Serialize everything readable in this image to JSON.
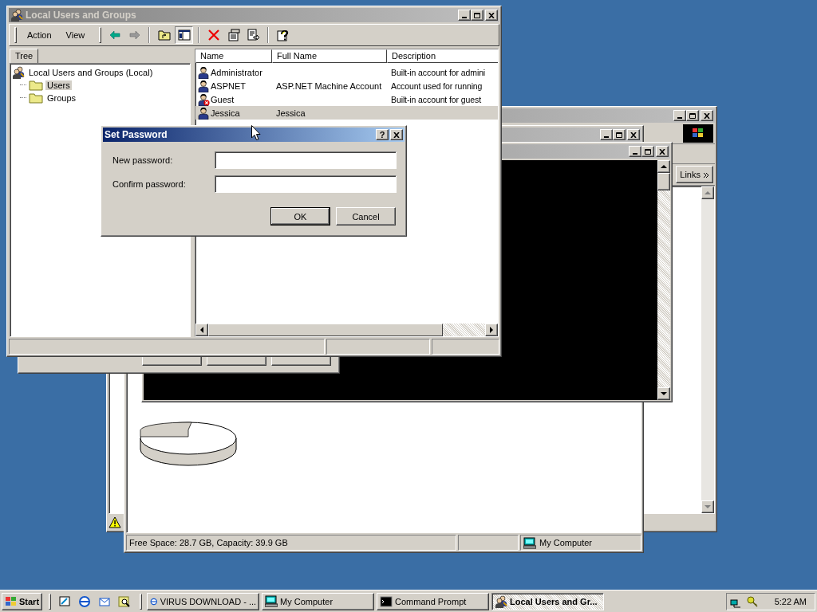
{
  "browser_window": {
    "links_label": "Links"
  },
  "explorer_window": {
    "status_bar": {
      "space": "Free Space: 28.7 GB, Capacity: 39.9 GB",
      "location": "My Computer"
    }
  },
  "main_window": {
    "title": "Local Users and Groups",
    "menu": [
      "Action",
      "View"
    ],
    "tree_tab": "Tree",
    "tree": [
      {
        "label": "Local Users and Groups (Local)",
        "selected": false,
        "children": [
          {
            "label": "Users",
            "selected": true
          },
          {
            "label": "Groups",
            "selected": false
          }
        ]
      }
    ],
    "columns": [
      "Name",
      "Full Name",
      "Description"
    ],
    "rows": [
      {
        "name": "Administrator",
        "full_name": "",
        "description": "Built-in account for admini",
        "disabled": false,
        "selected": false
      },
      {
        "name": "ASPNET",
        "full_name": "ASP.NET Machine Account",
        "description": "Account used for running",
        "disabled": false,
        "selected": false
      },
      {
        "name": "Guest",
        "full_name": "",
        "description": "Built-in account for guest",
        "disabled": true,
        "selected": false
      },
      {
        "name": "Jessica",
        "full_name": "Jessica",
        "description": "",
        "disabled": false,
        "selected": true
      }
    ]
  },
  "set_password_dialog": {
    "title": "Set Password",
    "help": "?",
    "fields": [
      {
        "label": "New password:"
      },
      {
        "label": "Confirm password:"
      }
    ],
    "buttons": [
      {
        "label": "OK",
        "default": true
      },
      {
        "label": "Cancel",
        "default": false
      }
    ]
  },
  "taskbar": {
    "start": "Start",
    "tasks": [
      {
        "label": "VIRUS DOWNLOAD - ...",
        "kind": "browser",
        "selected": false
      },
      {
        "label": "My Computer",
        "kind": "computer",
        "selected": false
      },
      {
        "label": "Command Prompt",
        "kind": "console",
        "selected": false
      },
      {
        "label": "Local Users and Gr...",
        "kind": "users",
        "selected": true
      }
    ],
    "clock": "5:22 AM"
  }
}
